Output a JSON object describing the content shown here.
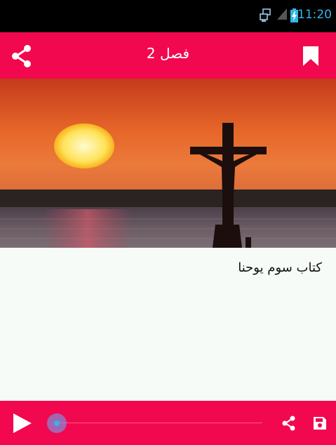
{
  "status_bar": {
    "time": "11:20",
    "icons": [
      "network-transfer-icon",
      "signal-icon",
      "battery-charging-icon"
    ]
  },
  "app_bar": {
    "title": "فصل 2",
    "share_icon": "share-icon",
    "bookmark_icon": "bookmark-icon",
    "color": "#f2084f"
  },
  "hero": {
    "image": "sunset-cross-photo"
  },
  "content": {
    "text": "كتاب سوم يوحنا"
  },
  "player": {
    "play_icon": "play-icon",
    "progress": 0.0,
    "share_icon": "share-icon",
    "save_icon": "save-icon",
    "accent": "#33b5e5"
  }
}
